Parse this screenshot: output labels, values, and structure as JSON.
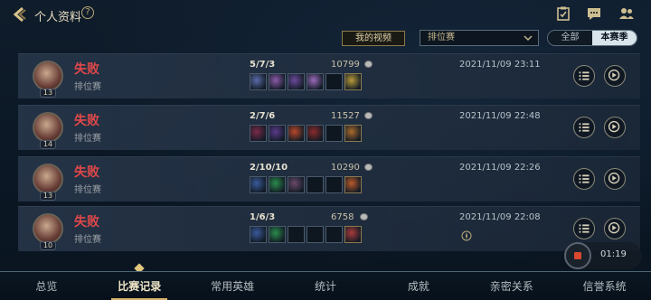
{
  "header": {
    "title": "个人资料",
    "help": "?"
  },
  "filters": {
    "my_videos": "我的视频",
    "queue_selected": "排位赛",
    "season_tabs": [
      "全部",
      "本赛季"
    ],
    "season_active": 1
  },
  "matches": [
    {
      "result": "失败",
      "mode": "排位赛",
      "level": "13",
      "kda": "5/7/3",
      "gold": "10799",
      "date": "2021/11/09 23:11"
    },
    {
      "result": "失败",
      "mode": "排位赛",
      "level": "14",
      "kda": "2/7/6",
      "gold": "11527",
      "date": "2021/11/09 22:48"
    },
    {
      "result": "失败",
      "mode": "排位赛",
      "level": "13",
      "kda": "2/10/10",
      "gold": "10290",
      "date": "2021/11/09 22:26"
    },
    {
      "result": "失败",
      "mode": "排位赛",
      "level": "10",
      "kda": "1/6/3",
      "gold": "6758",
      "date": "2021/11/09 22:08"
    }
  ],
  "recording": {
    "time": "01:19"
  },
  "nav": {
    "items": [
      "总览",
      "比赛记录",
      "常用英雄",
      "统计",
      "成就",
      "亲密关系",
      "信誉系统"
    ],
    "active": 1
  },
  "colors": {
    "defeat": "#e0484a",
    "accent_gold": "#d6b56a",
    "background": "#0a1420"
  }
}
